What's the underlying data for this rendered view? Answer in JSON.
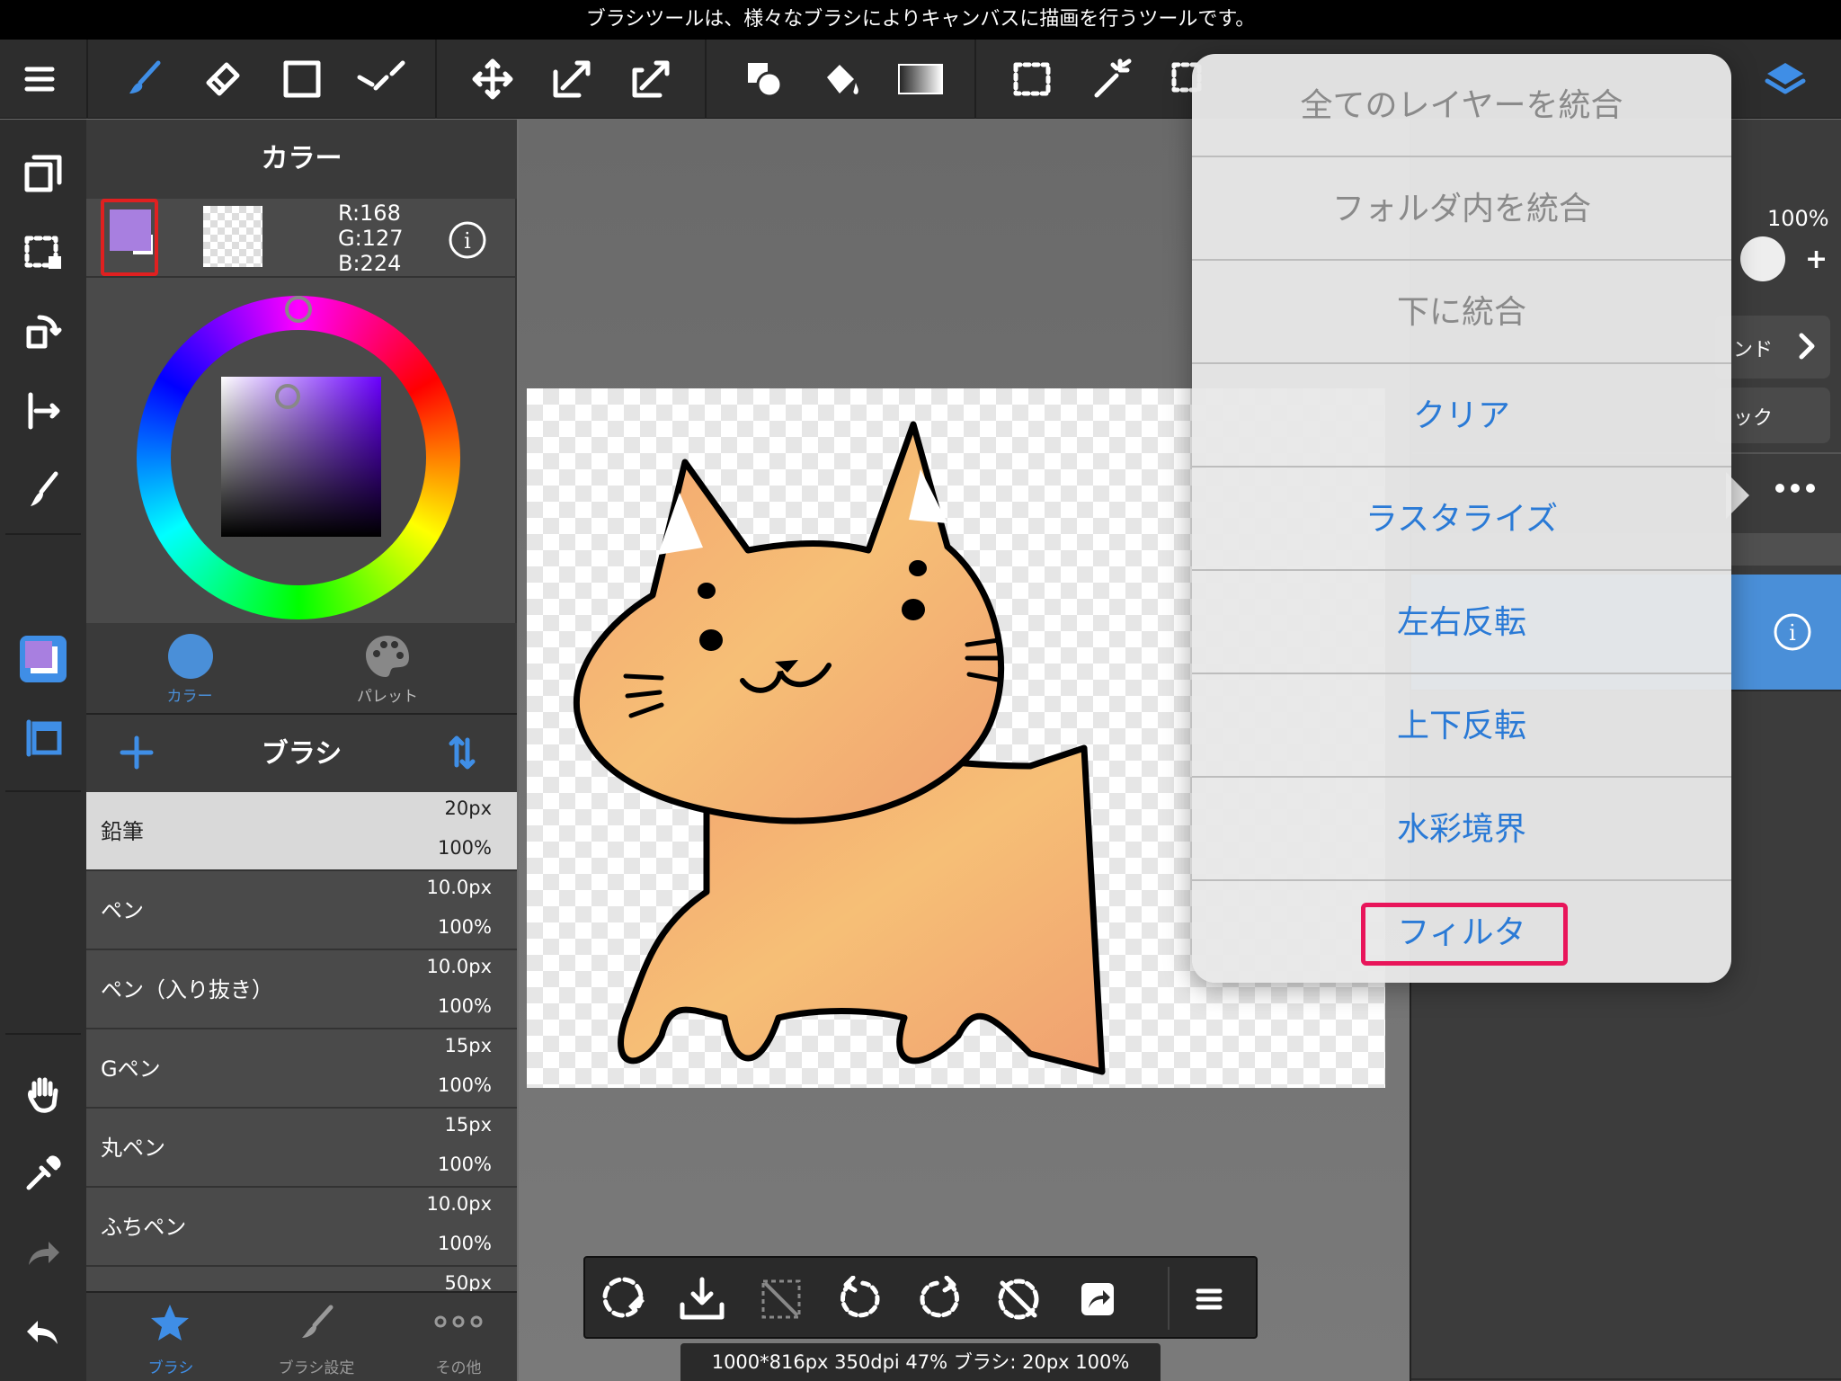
{
  "hint_bar": {
    "text": "ブラシツールは、様々なブラシによりキャンバスに描画を行うツールです。"
  },
  "color_panel": {
    "title": "カラー",
    "rgb": {
      "r": "R:168",
      "g": "G:127",
      "b": "B:224"
    },
    "primary_color": "#a87fe0",
    "tabs": [
      {
        "label": "カラー"
      },
      {
        "label": "パレット"
      }
    ]
  },
  "brush_panel": {
    "title": "ブラシ",
    "items": [
      {
        "name": "鉛筆",
        "size": "20px",
        "opacity": "100%"
      },
      {
        "name": "ペン",
        "size": "10.0px",
        "opacity": "100%"
      },
      {
        "name": "ペン（入り抜き）",
        "size": "10.0px",
        "opacity": "100%"
      },
      {
        "name": "Gペン",
        "size": "15px",
        "opacity": "100%"
      },
      {
        "name": "丸ペン",
        "size": "15px",
        "opacity": "100%"
      },
      {
        "name": "ふちペン",
        "size": "10.0px",
        "opacity": "100%"
      },
      {
        "name": "",
        "size": "50px",
        "opacity": ""
      }
    ],
    "tabs": [
      {
        "label": "ブラシ"
      },
      {
        "label": "ブラシ設定"
      },
      {
        "label": "その他"
      }
    ]
  },
  "right_panel": {
    "opacity": "100%",
    "blend_label": "ンド",
    "lock_label": "ック"
  },
  "status": {
    "text": "1000*816px 350dpi 47% ブラシ: 20px 100%"
  },
  "menu": {
    "items": [
      {
        "label": "全てのレイヤーを統合",
        "enabled": false
      },
      {
        "label": "フォルダ内を統合",
        "enabled": false
      },
      {
        "label": "下に統合",
        "enabled": false
      },
      {
        "label": "クリア",
        "enabled": true
      },
      {
        "label": "ラスタライズ",
        "enabled": true
      },
      {
        "label": "左右反転",
        "enabled": true
      },
      {
        "label": "上下反転",
        "enabled": true
      },
      {
        "label": "水彩境界",
        "enabled": true
      },
      {
        "label": "フィルタ",
        "enabled": true
      }
    ]
  },
  "colors": {
    "accent": "#3f8ee6",
    "highlight": "#e8155a",
    "selection_red": "#e02020"
  }
}
